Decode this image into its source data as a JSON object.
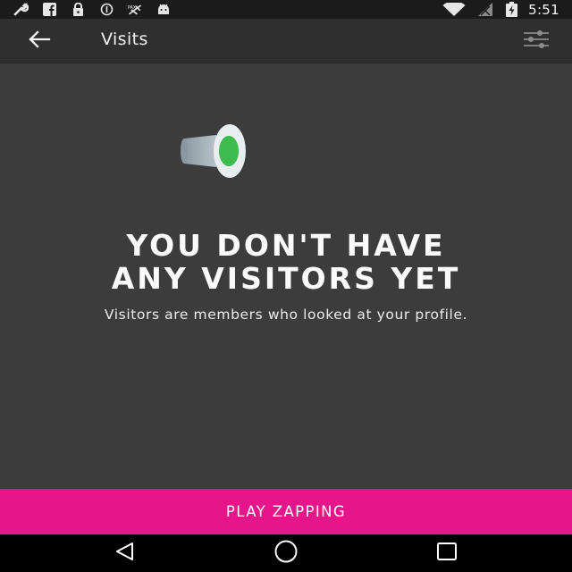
{
  "status_bar": {
    "time": "5:51",
    "left_icons": [
      "wrench-icon",
      "facebook-icon",
      "lock-icon",
      "data-saver-icon",
      "no-signal-carrier-icon",
      "android-icon"
    ],
    "right_icons": [
      "wifi-icon",
      "signal-icon",
      "battery-charging-icon"
    ]
  },
  "app_bar": {
    "title": "Visits",
    "back_icon": "arrow-left-icon",
    "filter_icon": "sliders-icon"
  },
  "empty_state": {
    "illustration": "hat-icon",
    "title": "YOU DON'T HAVE\nANY VISITORS YET",
    "subtitle": "Visitors are members who looked at your profile."
  },
  "cta": {
    "label": "PLAY ZAPPING",
    "color": "#e6158a"
  },
  "nav_bar": {
    "icons": [
      "back-triangle-icon",
      "home-circle-icon",
      "recents-square-icon"
    ]
  },
  "colors": {
    "status_bar": "#1b1b1b",
    "app_bar": "#2f2f2f",
    "content": "#3c3c3c",
    "hat_accent": "#3dbb4f"
  }
}
